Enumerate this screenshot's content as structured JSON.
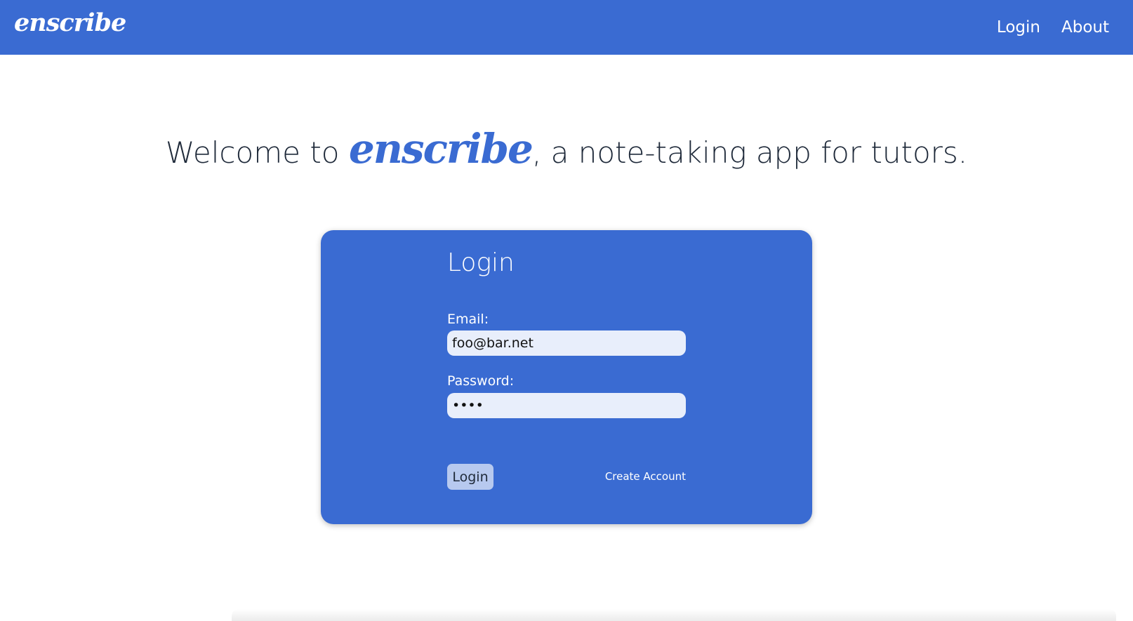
{
  "navbar": {
    "brand": "enscribe",
    "links": [
      {
        "label": "Login"
      },
      {
        "label": "About"
      }
    ]
  },
  "welcome": {
    "prefix": "Welcome to ",
    "brand": "enscribe",
    "suffix": ", a note-taking app for tutors."
  },
  "login_form": {
    "title": "Login",
    "email_label": "Email:",
    "email_value": "foo@bar.net",
    "password_label": "Password:",
    "password_value": "••••",
    "submit_label": "Login",
    "create_account_label": "Create Account"
  },
  "colors": {
    "primary": "#3a6bd2",
    "input_bg": "#e8eefb",
    "button_bg": "#b7c9ef"
  }
}
